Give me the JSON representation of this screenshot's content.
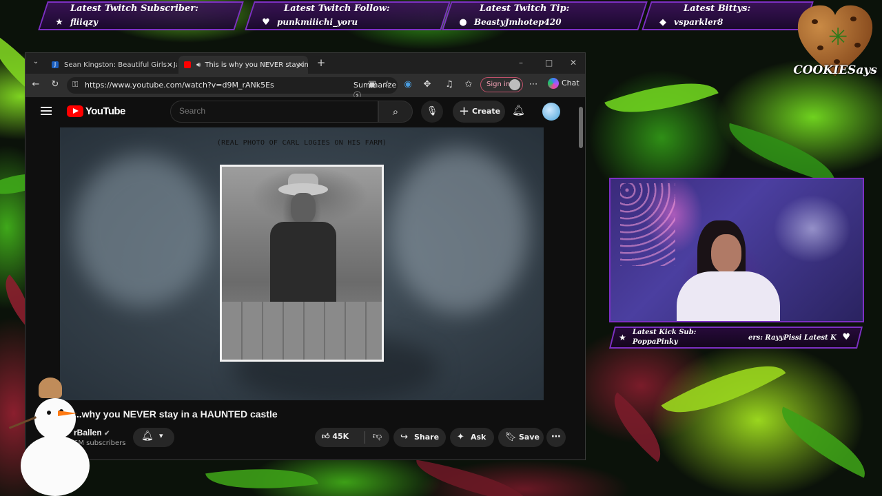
{
  "overlay": {
    "alerts": [
      {
        "label": "Latest Twitch Subscriber:",
        "value": "fliiqzy",
        "icon": "star-icon"
      },
      {
        "label": "Latest Twitch Follow:",
        "value": "punkmiiichi_yoru",
        "icon": "heart-icon"
      },
      {
        "label": "Latest Twitch Tip:",
        "value": "BeastyJmhotep420",
        "icon": "coin-icon"
      },
      {
        "label": "Latest Bittys:",
        "value": "vsparkler8",
        "icon": "diamond-icon"
      }
    ],
    "logo_text": "COOKIESays",
    "cam_label": {
      "line1": "Latest Kick Sub:",
      "line2": "PoppaPinky",
      "ticker": "ers: RayyPissi   Latest K"
    }
  },
  "browser": {
    "tabs": [
      {
        "title": "Sean Kingston: Beautiful Girls - Jan",
        "active": false
      },
      {
        "title": "This is why you NEVER stay in",
        "active": true
      }
    ],
    "url": "https://www.youtube.com/watch?v=d9M_rANk5Es",
    "summarize_label": "Summarize",
    "signin_label": "Sign in",
    "chat_label": "Chat",
    "window_controls": {
      "minimize": "–",
      "maximize": "□",
      "close": "✕"
    }
  },
  "youtube": {
    "logo_text": "YouTube",
    "search_placeholder": "Search",
    "create_label": "Create",
    "video": {
      "caption": "(REAL PHOTO OF CARL LOGIES ON HIS FARM)",
      "title": "...why you NEVER stay in a HAUNTED castle",
      "channel": "rBallen",
      "subscribers": "6M subscribers",
      "likes": "45K",
      "share_label": "Share",
      "ask_label": "Ask",
      "save_label": "Save"
    }
  },
  "colors": {
    "accent_purple": "#7d2fc4",
    "youtube_red": "#ff0000",
    "leaf_green": "#5ab61c",
    "leaf_red": "#8b1f2e"
  }
}
